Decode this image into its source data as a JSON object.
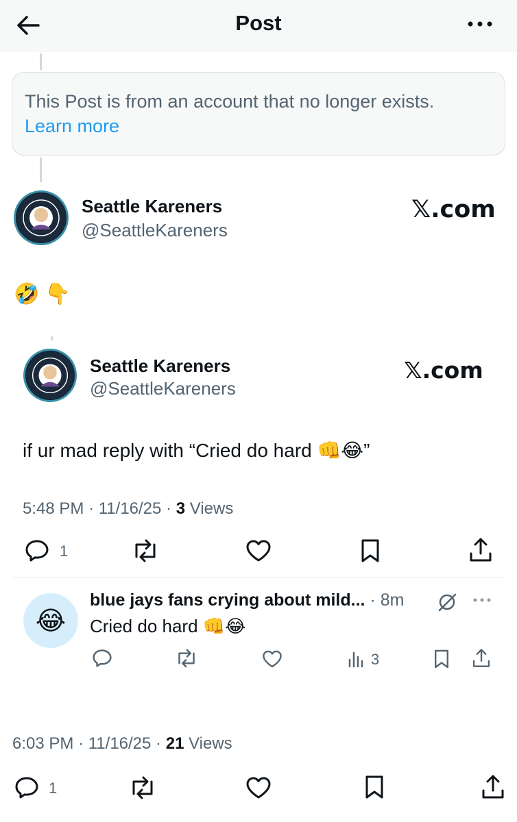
{
  "header": {
    "title": "Post"
  },
  "notice": {
    "text": "This Post is from an account that no longer exists.",
    "link": "Learn more"
  },
  "embed1": {
    "name": "Seattle Kareners",
    "handle": "@SeattleKareners",
    "watermark": "𝕏.com",
    "text": "🤣 👇"
  },
  "embed2": {
    "name": "Seattle Kareners",
    "handle": "@SeattleKareners",
    "watermark": "𝕏.com",
    "text": "if ur mad reply with “Cried do hard 👊😂”",
    "time": "5:48 PM",
    "date": "11/16/25",
    "views_count": "3",
    "views_label": "Views",
    "reply_count": "1"
  },
  "reply": {
    "name": "blue jays fans crying about mild...",
    "age": "8m",
    "text": "Cried do hard 👊😂",
    "views": "3",
    "avatar_emoji": "😂"
  },
  "main": {
    "time": "6:03 PM",
    "date": "11/16/25",
    "views_count": "21",
    "views_label": "Views",
    "reply_count": "1"
  },
  "separators": {
    "dot": "·"
  }
}
